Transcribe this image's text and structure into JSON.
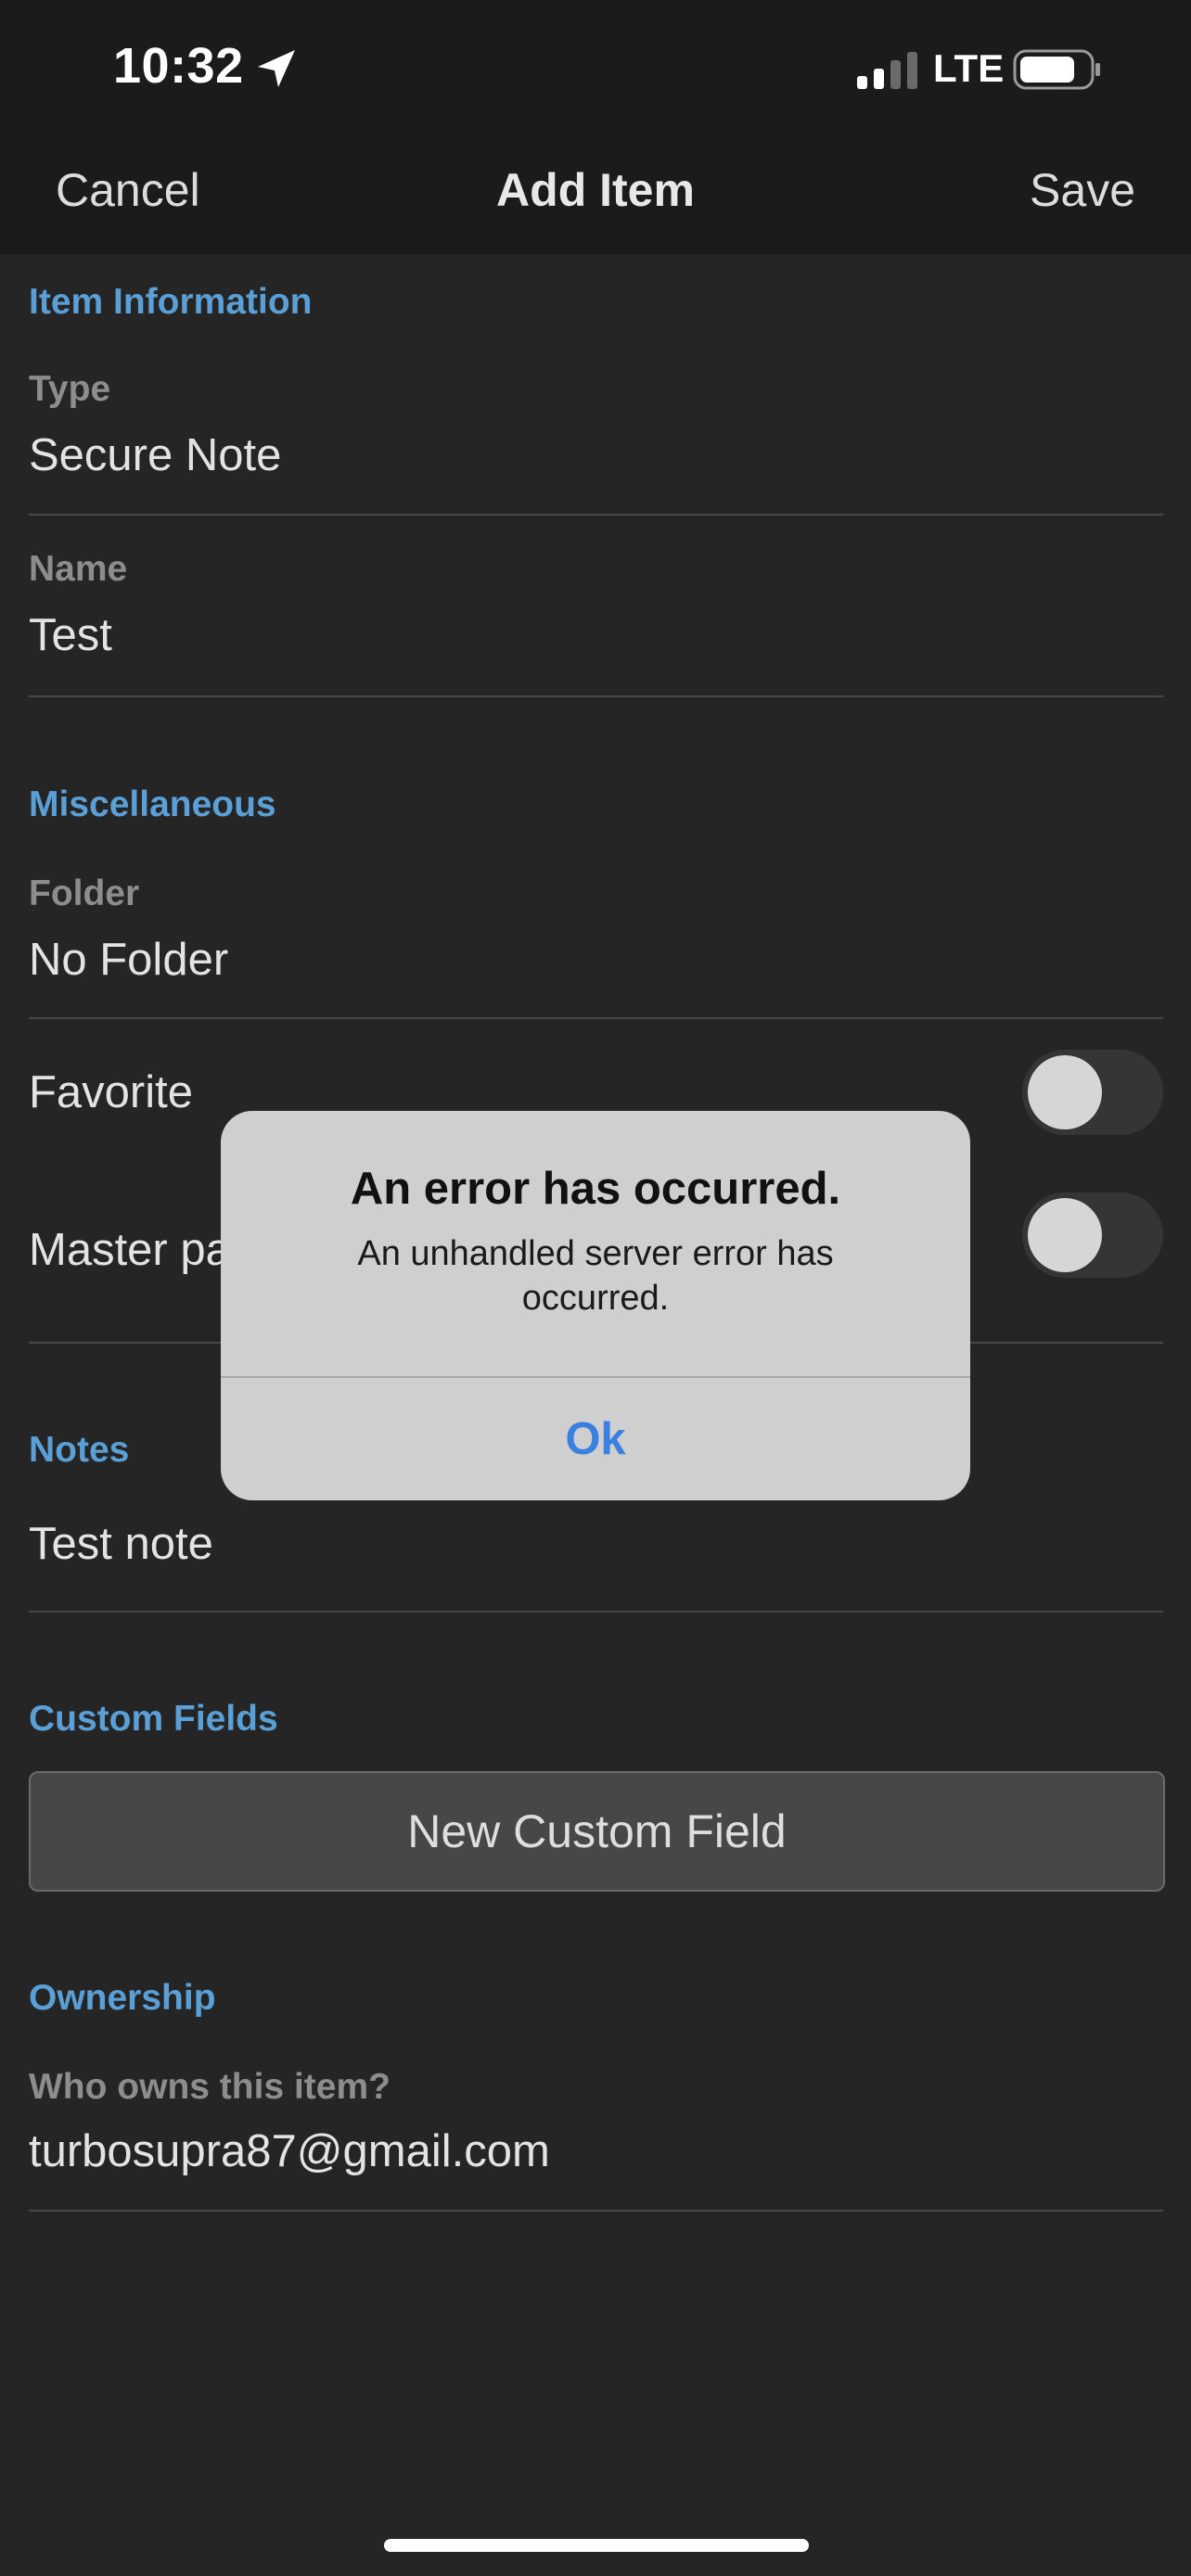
{
  "status_bar": {
    "time": "10:32",
    "network": "LTE",
    "icons": [
      "location-arrow-icon",
      "signal-bars-icon",
      "battery-icon"
    ]
  },
  "nav": {
    "cancel": "Cancel",
    "title": "Add Item",
    "save": "Save"
  },
  "item_information": {
    "header": "Item Information",
    "type_label": "Type",
    "type_value": "Secure Note",
    "name_label": "Name",
    "name_value": "Test"
  },
  "miscellaneous": {
    "header": "Miscellaneous",
    "folder_label": "Folder",
    "folder_value": "No Folder",
    "favorite_label": "Favorite",
    "favorite_on": false,
    "master_password_label": "Master pa",
    "master_password_on": false
  },
  "notes": {
    "header": "Notes",
    "value": "Test note"
  },
  "custom_fields": {
    "header": "Custom Fields",
    "button": "New Custom Field"
  },
  "ownership": {
    "header": "Ownership",
    "label": "Who owns this item?",
    "value": "turbosupra87@gmail.com"
  },
  "alert": {
    "title": "An error has occurred.",
    "message": "An unhandled server error has occurred.",
    "ok": "Ok"
  },
  "colors": {
    "accent": "#5a9fd6",
    "alert_button": "#3a80e0",
    "background": "#252525",
    "bars": "#1b1b1b"
  }
}
